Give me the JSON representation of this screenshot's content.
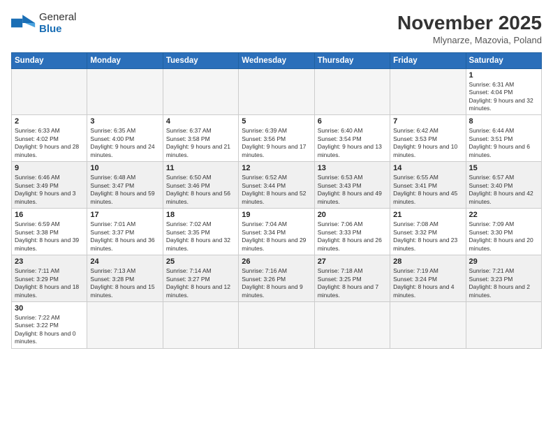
{
  "header": {
    "logo_general": "General",
    "logo_blue": "Blue",
    "month_title": "November 2025",
    "subtitle": "Mlynarze, Mazovia, Poland"
  },
  "weekdays": [
    "Sunday",
    "Monday",
    "Tuesday",
    "Wednesday",
    "Thursday",
    "Friday",
    "Saturday"
  ],
  "weeks": [
    {
      "shade": false,
      "days": [
        {
          "num": "",
          "info": ""
        },
        {
          "num": "",
          "info": ""
        },
        {
          "num": "",
          "info": ""
        },
        {
          "num": "",
          "info": ""
        },
        {
          "num": "",
          "info": ""
        },
        {
          "num": "",
          "info": ""
        },
        {
          "num": "1",
          "info": "Sunrise: 6:31 AM\nSunset: 4:04 PM\nDaylight: 9 hours and 32 minutes."
        }
      ]
    },
    {
      "shade": false,
      "days": [
        {
          "num": "2",
          "info": "Sunrise: 6:33 AM\nSunset: 4:02 PM\nDaylight: 9 hours and 28 minutes."
        },
        {
          "num": "3",
          "info": "Sunrise: 6:35 AM\nSunset: 4:00 PM\nDaylight: 9 hours and 24 minutes."
        },
        {
          "num": "4",
          "info": "Sunrise: 6:37 AM\nSunset: 3:58 PM\nDaylight: 9 hours and 21 minutes."
        },
        {
          "num": "5",
          "info": "Sunrise: 6:39 AM\nSunset: 3:56 PM\nDaylight: 9 hours and 17 minutes."
        },
        {
          "num": "6",
          "info": "Sunrise: 6:40 AM\nSunset: 3:54 PM\nDaylight: 9 hours and 13 minutes."
        },
        {
          "num": "7",
          "info": "Sunrise: 6:42 AM\nSunset: 3:53 PM\nDaylight: 9 hours and 10 minutes."
        },
        {
          "num": "8",
          "info": "Sunrise: 6:44 AM\nSunset: 3:51 PM\nDaylight: 9 hours and 6 minutes."
        }
      ]
    },
    {
      "shade": true,
      "days": [
        {
          "num": "9",
          "info": "Sunrise: 6:46 AM\nSunset: 3:49 PM\nDaylight: 9 hours and 3 minutes."
        },
        {
          "num": "10",
          "info": "Sunrise: 6:48 AM\nSunset: 3:47 PM\nDaylight: 8 hours and 59 minutes."
        },
        {
          "num": "11",
          "info": "Sunrise: 6:50 AM\nSunset: 3:46 PM\nDaylight: 8 hours and 56 minutes."
        },
        {
          "num": "12",
          "info": "Sunrise: 6:52 AM\nSunset: 3:44 PM\nDaylight: 8 hours and 52 minutes."
        },
        {
          "num": "13",
          "info": "Sunrise: 6:53 AM\nSunset: 3:43 PM\nDaylight: 8 hours and 49 minutes."
        },
        {
          "num": "14",
          "info": "Sunrise: 6:55 AM\nSunset: 3:41 PM\nDaylight: 8 hours and 45 minutes."
        },
        {
          "num": "15",
          "info": "Sunrise: 6:57 AM\nSunset: 3:40 PM\nDaylight: 8 hours and 42 minutes."
        }
      ]
    },
    {
      "shade": false,
      "days": [
        {
          "num": "16",
          "info": "Sunrise: 6:59 AM\nSunset: 3:38 PM\nDaylight: 8 hours and 39 minutes."
        },
        {
          "num": "17",
          "info": "Sunrise: 7:01 AM\nSunset: 3:37 PM\nDaylight: 8 hours and 36 minutes."
        },
        {
          "num": "18",
          "info": "Sunrise: 7:02 AM\nSunset: 3:35 PM\nDaylight: 8 hours and 32 minutes."
        },
        {
          "num": "19",
          "info": "Sunrise: 7:04 AM\nSunset: 3:34 PM\nDaylight: 8 hours and 29 minutes."
        },
        {
          "num": "20",
          "info": "Sunrise: 7:06 AM\nSunset: 3:33 PM\nDaylight: 8 hours and 26 minutes."
        },
        {
          "num": "21",
          "info": "Sunrise: 7:08 AM\nSunset: 3:32 PM\nDaylight: 8 hours and 23 minutes."
        },
        {
          "num": "22",
          "info": "Sunrise: 7:09 AM\nSunset: 3:30 PM\nDaylight: 8 hours and 20 minutes."
        }
      ]
    },
    {
      "shade": true,
      "days": [
        {
          "num": "23",
          "info": "Sunrise: 7:11 AM\nSunset: 3:29 PM\nDaylight: 8 hours and 18 minutes."
        },
        {
          "num": "24",
          "info": "Sunrise: 7:13 AM\nSunset: 3:28 PM\nDaylight: 8 hours and 15 minutes."
        },
        {
          "num": "25",
          "info": "Sunrise: 7:14 AM\nSunset: 3:27 PM\nDaylight: 8 hours and 12 minutes."
        },
        {
          "num": "26",
          "info": "Sunrise: 7:16 AM\nSunset: 3:26 PM\nDaylight: 8 hours and 9 minutes."
        },
        {
          "num": "27",
          "info": "Sunrise: 7:18 AM\nSunset: 3:25 PM\nDaylight: 8 hours and 7 minutes."
        },
        {
          "num": "28",
          "info": "Sunrise: 7:19 AM\nSunset: 3:24 PM\nDaylight: 8 hours and 4 minutes."
        },
        {
          "num": "29",
          "info": "Sunrise: 7:21 AM\nSunset: 3:23 PM\nDaylight: 8 hours and 2 minutes."
        }
      ]
    },
    {
      "shade": false,
      "days": [
        {
          "num": "30",
          "info": "Sunrise: 7:22 AM\nSunset: 3:22 PM\nDaylight: 8 hours and 0 minutes."
        },
        {
          "num": "",
          "info": ""
        },
        {
          "num": "",
          "info": ""
        },
        {
          "num": "",
          "info": ""
        },
        {
          "num": "",
          "info": ""
        },
        {
          "num": "",
          "info": ""
        },
        {
          "num": "",
          "info": ""
        }
      ]
    }
  ]
}
